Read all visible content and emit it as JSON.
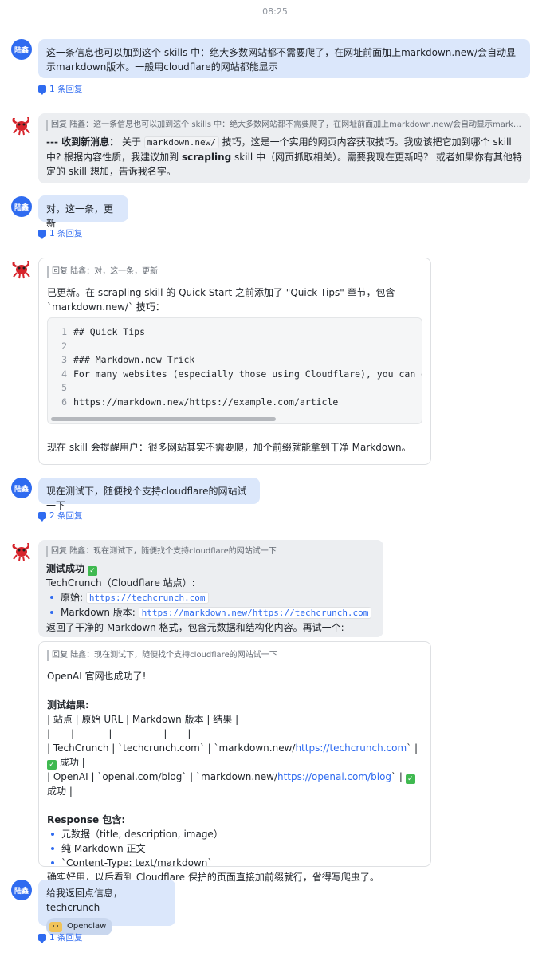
{
  "time": "08:25",
  "user_name": "陆鑫",
  "msg1": {
    "text": "这一条信息也可以加到这个 skills 中：绝大多数网站都不需要爬了，在网址前面加上markdown.new/会自动显示markdown版本。一般用cloudflare的网站都能显示",
    "reply_count": "1 条回复"
  },
  "msg2": {
    "quote": "回复 陆鑫：这一条信息也可以加到这个 skills 中：绝大多数网站都不需要爬了，在网址前面加上markdown.new/会自动显示markdown...",
    "lead": "--- 收到新消息：",
    "t1": " 关于 ",
    "code": "markdown.new/",
    "t2": " 技巧，这是一个实用的网页内容获取技巧。我应该把它加到哪个 skill 中? 根据内容性质，我建议加到 ",
    "bold": "scrapling",
    "t3": " skill 中（网页抓取相关）。需要我现在更新吗？ 或者如果你有其他特定的 skill 想加，告诉我名字。"
  },
  "msg3": {
    "text": "对，这一条，更新",
    "reply_count": "1 条回复"
  },
  "msg4": {
    "quote": "回复 陆鑫：对，这一条，更新",
    "intro": "已更新。在 scrapling skill 的 Quick Start 之前添加了 \"Quick Tips\" 章节，包含 `markdown.new/` 技巧：",
    "code_lines": [
      {
        "n": "1",
        "t": "## Quick Tips"
      },
      {
        "n": "2",
        "t": ""
      },
      {
        "n": "3",
        "t": "### Markdown.new Trick"
      },
      {
        "n": "4",
        "t": "For many websites (especially those using Cloudflare), you can g"
      },
      {
        "n": "5",
        "t": ""
      },
      {
        "n": "6",
        "t": "https://markdown.new/https://example.com/article"
      }
    ],
    "outro": "现在 skill 会提醒用户：很多网站其实不需要爬，加个前缀就能拿到干净 Markdown。"
  },
  "msg5": {
    "text": "现在测试下，随便找个支持cloudflare的网站试一下",
    "reply_count": "2 条回复"
  },
  "msg6": {
    "quote": "回复 陆鑫：现在测试下，随便找个支持cloudflare的网站试一下",
    "title": "测试成功",
    "site": "TechCrunch（Cloudflare 站点）:",
    "b1_label": "原始: ",
    "b1_code": "https://techcrunch.com",
    "b2_label": "Markdown 版本: ",
    "b2_code": "https://markdown.new/https://techcrunch.com",
    "outro": "返回了干净的 Markdown 格式，包含元数据和结构化内容。再试一个:"
  },
  "msg7": {
    "quote": "回复 陆鑫：现在测试下，随便找个支持cloudflare的网站试一下",
    "l1": "OpenAI 官网也成功了!",
    "results_title": "测试结果:",
    "row_header": "| 站点 | 原始 URL | Markdown 版本 | 结果 |",
    "row_sep": "|------|----------|---------------|------|",
    "row1_a": "| TechCrunch | `techcrunch.com` | `markdown.new/",
    "row1_link": "https://techcrunch.com",
    "row1_b": "` | ",
    "row1_c": " 成功 |",
    "row2_a": "| OpenAI | `openai.com/blog` | `markdown.new/",
    "row2_link": "https://openai.com/blog",
    "row2_b": "` | ",
    "row2_c": " 成功 |",
    "resp_title": "Response 包含:",
    "resp_items": [
      "元数据（title, description, image）",
      "纯 Markdown 正文",
      "`Content-Type: text/markdown`"
    ],
    "outro": "确实好用，以后看到 Cloudflare 保护的页面直接加前缀就行，省得写爬虫了。"
  },
  "msg8": {
    "text": "给我返回点信息，techcrunch",
    "chip": "Openclaw",
    "reply_count": "1 条回复"
  }
}
